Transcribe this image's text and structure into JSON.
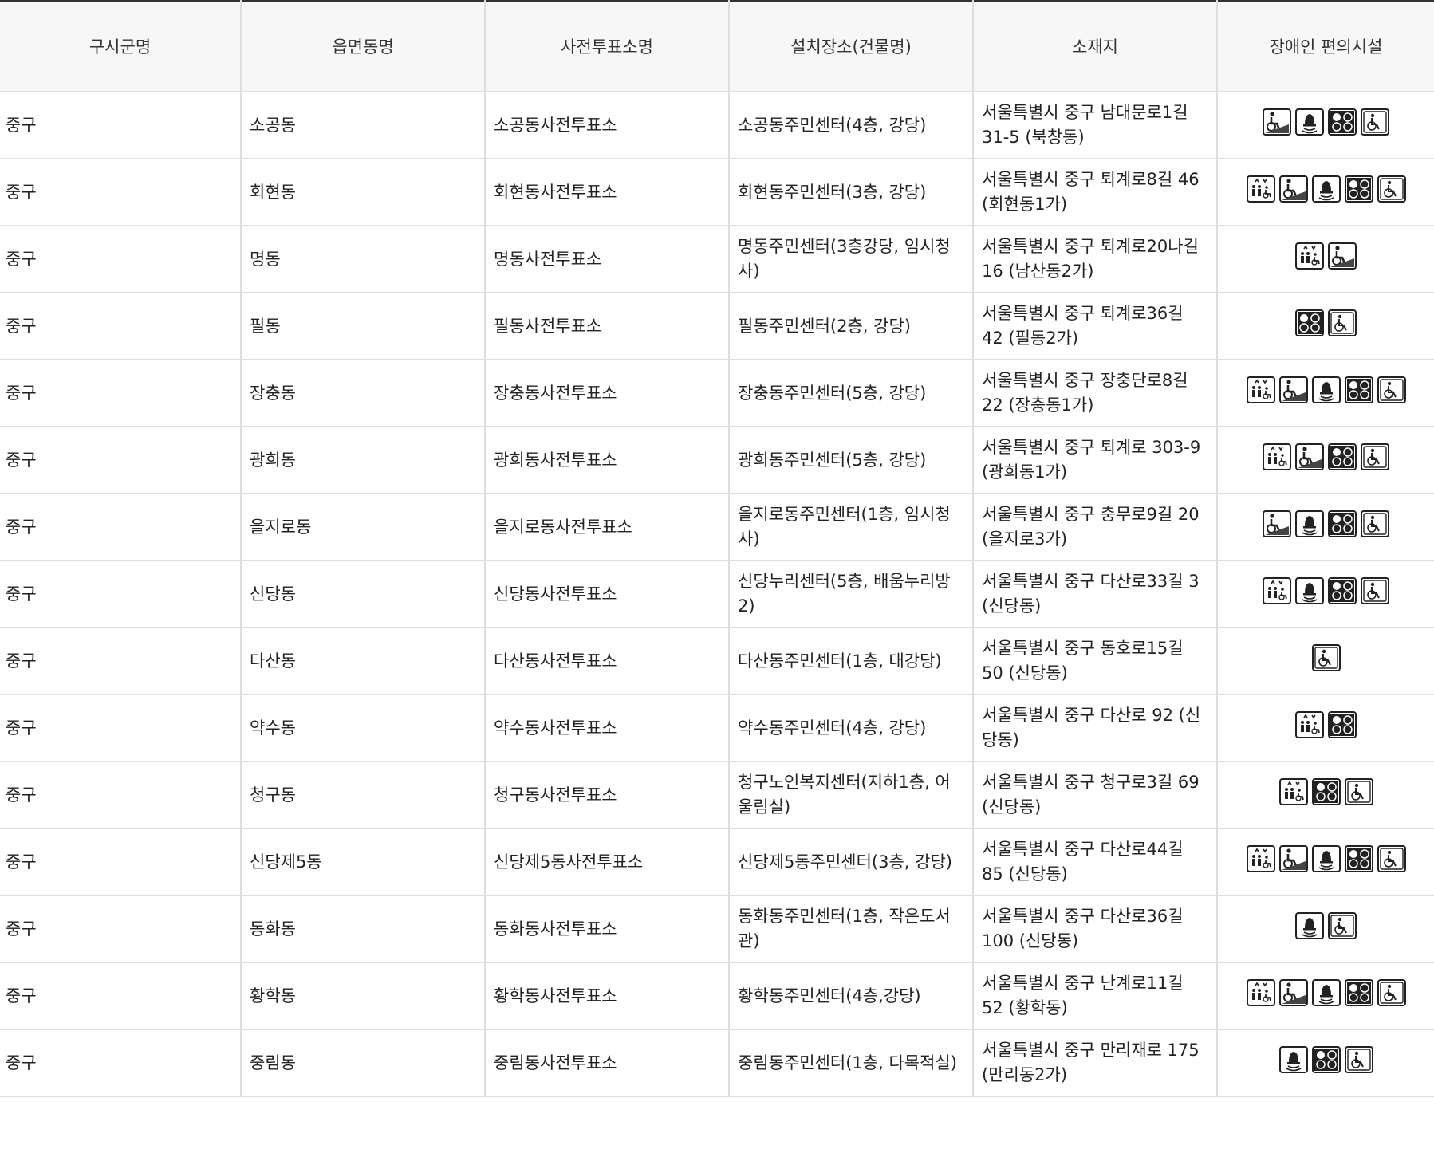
{
  "table": {
    "headers": [
      "구시군명",
      "읍면동명",
      "사전투표소명",
      "설치장소(건물명)",
      "소재지",
      "장애인 편의시설"
    ],
    "rows": [
      {
        "sigungu": "중구",
        "dong": "소공동",
        "station": "소공동사전투표소",
        "place": "소공동주민센터(4층, 강당)",
        "address": "서울특별시 중구 남대문로1길 31-5 (북창동)",
        "facilities": [
          "ramp-icon",
          "bell-icon",
          "braille-icon",
          "wheelchair-icon"
        ]
      },
      {
        "sigungu": "중구",
        "dong": "회현동",
        "station": "회현동사전투표소",
        "place": "회현동주민센터(3층, 강당)",
        "address": "서울특별시 중구 퇴계로8길 46 (회현동1가)",
        "facilities": [
          "elevator-icon",
          "ramp-icon",
          "bell-icon",
          "braille-icon",
          "wheelchair-icon"
        ]
      },
      {
        "sigungu": "중구",
        "dong": "명동",
        "station": "명동사전투표소",
        "place": "명동주민센터(3층강당, 임시청사)",
        "address": "서울특별시 중구 퇴계로20나길 16 (남산동2가)",
        "facilities": [
          "elevator-icon",
          "ramp-icon"
        ]
      },
      {
        "sigungu": "중구",
        "dong": "필동",
        "station": "필동사전투표소",
        "place": "필동주민센터(2층, 강당)",
        "address": "서울특별시 중구 퇴계로36길 42 (필동2가)",
        "facilities": [
          "braille-icon",
          "wheelchair-icon"
        ]
      },
      {
        "sigungu": "중구",
        "dong": "장충동",
        "station": "장충동사전투표소",
        "place": "장충동주민센터(5층, 강당)",
        "address": "서울특별시 중구 장충단로8길 22 (장충동1가)",
        "facilities": [
          "elevator-icon",
          "ramp-icon",
          "bell-icon",
          "braille-icon",
          "wheelchair-icon"
        ]
      },
      {
        "sigungu": "중구",
        "dong": "광희동",
        "station": "광희동사전투표소",
        "place": "광희동주민센터(5층, 강당)",
        "address": "서울특별시 중구 퇴계로 303-9 (광희동1가)",
        "facilities": [
          "elevator-icon",
          "ramp-icon",
          "braille-icon",
          "wheelchair-icon"
        ]
      },
      {
        "sigungu": "중구",
        "dong": "을지로동",
        "station": "을지로동사전투표소",
        "place": "을지로동주민센터(1층, 임시청사)",
        "address": "서울특별시 중구 충무로9길 20 (을지로3가)",
        "facilities": [
          "ramp-icon",
          "bell-icon",
          "braille-icon",
          "wheelchair-icon"
        ]
      },
      {
        "sigungu": "중구",
        "dong": "신당동",
        "station": "신당동사전투표소",
        "place": "신당누리센터(5층, 배움누리방2)",
        "address": "서울특별시 중구 다산로33길 3 (신당동)",
        "facilities": [
          "elevator-icon",
          "bell-icon",
          "braille-icon",
          "wheelchair-icon"
        ]
      },
      {
        "sigungu": "중구",
        "dong": "다산동",
        "station": "다산동사전투표소",
        "place": "다산동주민센터(1층, 대강당)",
        "address": "서울특별시 중구 동호로15길 50 (신당동)",
        "facilities": [
          "wheelchair-icon"
        ]
      },
      {
        "sigungu": "중구",
        "dong": "약수동",
        "station": "약수동사전투표소",
        "place": "약수동주민센터(4층, 강당)",
        "address": "서울특별시 중구 다산로 92 (신당동)",
        "facilities": [
          "elevator-icon",
          "braille-icon"
        ]
      },
      {
        "sigungu": "중구",
        "dong": "청구동",
        "station": "청구동사전투표소",
        "place": "청구노인복지센터(지하1층, 어울림실)",
        "address": "서울특별시 중구 청구로3길 69 (신당동)",
        "facilities": [
          "elevator-icon",
          "braille-icon",
          "wheelchair-icon"
        ]
      },
      {
        "sigungu": "중구",
        "dong": "신당제5동",
        "station": "신당제5동사전투표소",
        "place": "신당제5동주민센터(3층, 강당)",
        "address": "서울특별시 중구 다산로44길 85 (신당동)",
        "facilities": [
          "elevator-icon",
          "ramp-icon",
          "bell-icon",
          "braille-icon",
          "wheelchair-icon"
        ]
      },
      {
        "sigungu": "중구",
        "dong": "동화동",
        "station": "동화동사전투표소",
        "place": "동화동주민센터(1층, 작은도서관)",
        "address": "서울특별시 중구 다산로36길 100 (신당동)",
        "facilities": [
          "bell-icon",
          "wheelchair-icon"
        ]
      },
      {
        "sigungu": "중구",
        "dong": "황학동",
        "station": "황학동사전투표소",
        "place": "황학동주민센터(4층,강당)",
        "address": "서울특별시 중구 난계로11길 52 (황학동)",
        "facilities": [
          "elevator-icon",
          "ramp-icon",
          "bell-icon",
          "braille-icon",
          "wheelchair-icon"
        ]
      },
      {
        "sigungu": "중구",
        "dong": "중림동",
        "station": "중림동사전투표소",
        "place": "중림동주민센터(1층, 다목적실)",
        "address": "서울특별시 중구 만리재로 175 (만리동2가)",
        "facilities": [
          "bell-icon",
          "braille-icon",
          "wheelchair-icon"
        ]
      }
    ]
  }
}
